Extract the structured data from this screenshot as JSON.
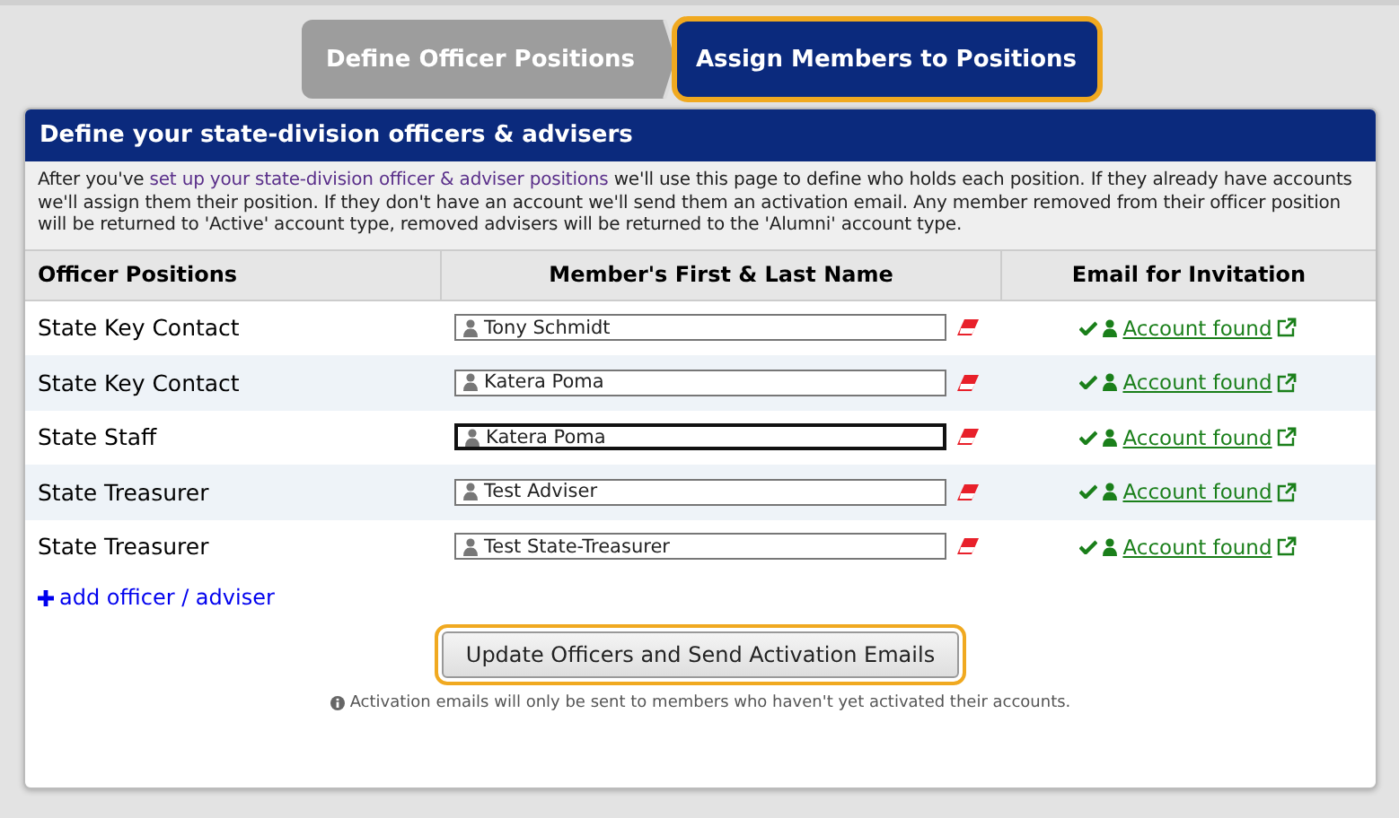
{
  "steps": [
    {
      "label": "Define Officer Positions",
      "selected": false
    },
    {
      "label": "Assign Members to Positions",
      "selected": true
    }
  ],
  "card": {
    "title": "Define your state-division officers & advisers",
    "intro_before": "After you've ",
    "intro_link": "set up your state-division officer & adviser positions",
    "intro_after": " we'll use this page to define who holds each position. If they already have accounts we'll assign them their position. If they don't have an account we'll send them an activation email. Any member removed from their officer position will be returned to 'Active' account type, removed advisers will be returned to the 'Alumni' account type.",
    "columns": [
      "Officer Positions",
      "Member's First & Last Name",
      "Email for Invitation"
    ],
    "rows": [
      {
        "position": "State Key Contact",
        "member": "Tony Schmidt",
        "focused": false,
        "status": "Account found"
      },
      {
        "position": "State Key Contact",
        "member": "Katera Poma",
        "focused": false,
        "status": "Account found"
      },
      {
        "position": "State Staff",
        "member": "Katera Poma",
        "focused": true,
        "status": "Account found"
      },
      {
        "position": "State Treasurer",
        "member": "Test Adviser",
        "focused": false,
        "status": "Account found"
      },
      {
        "position": "State Treasurer",
        "member": "Test State-Treasurer",
        "focused": false,
        "status": "Account found"
      }
    ],
    "add_link": "add officer / adviser",
    "submit": "Update Officers and Send Activation Emails",
    "note": "Activation emails will only be sent to members who haven't yet activated their accounts."
  }
}
